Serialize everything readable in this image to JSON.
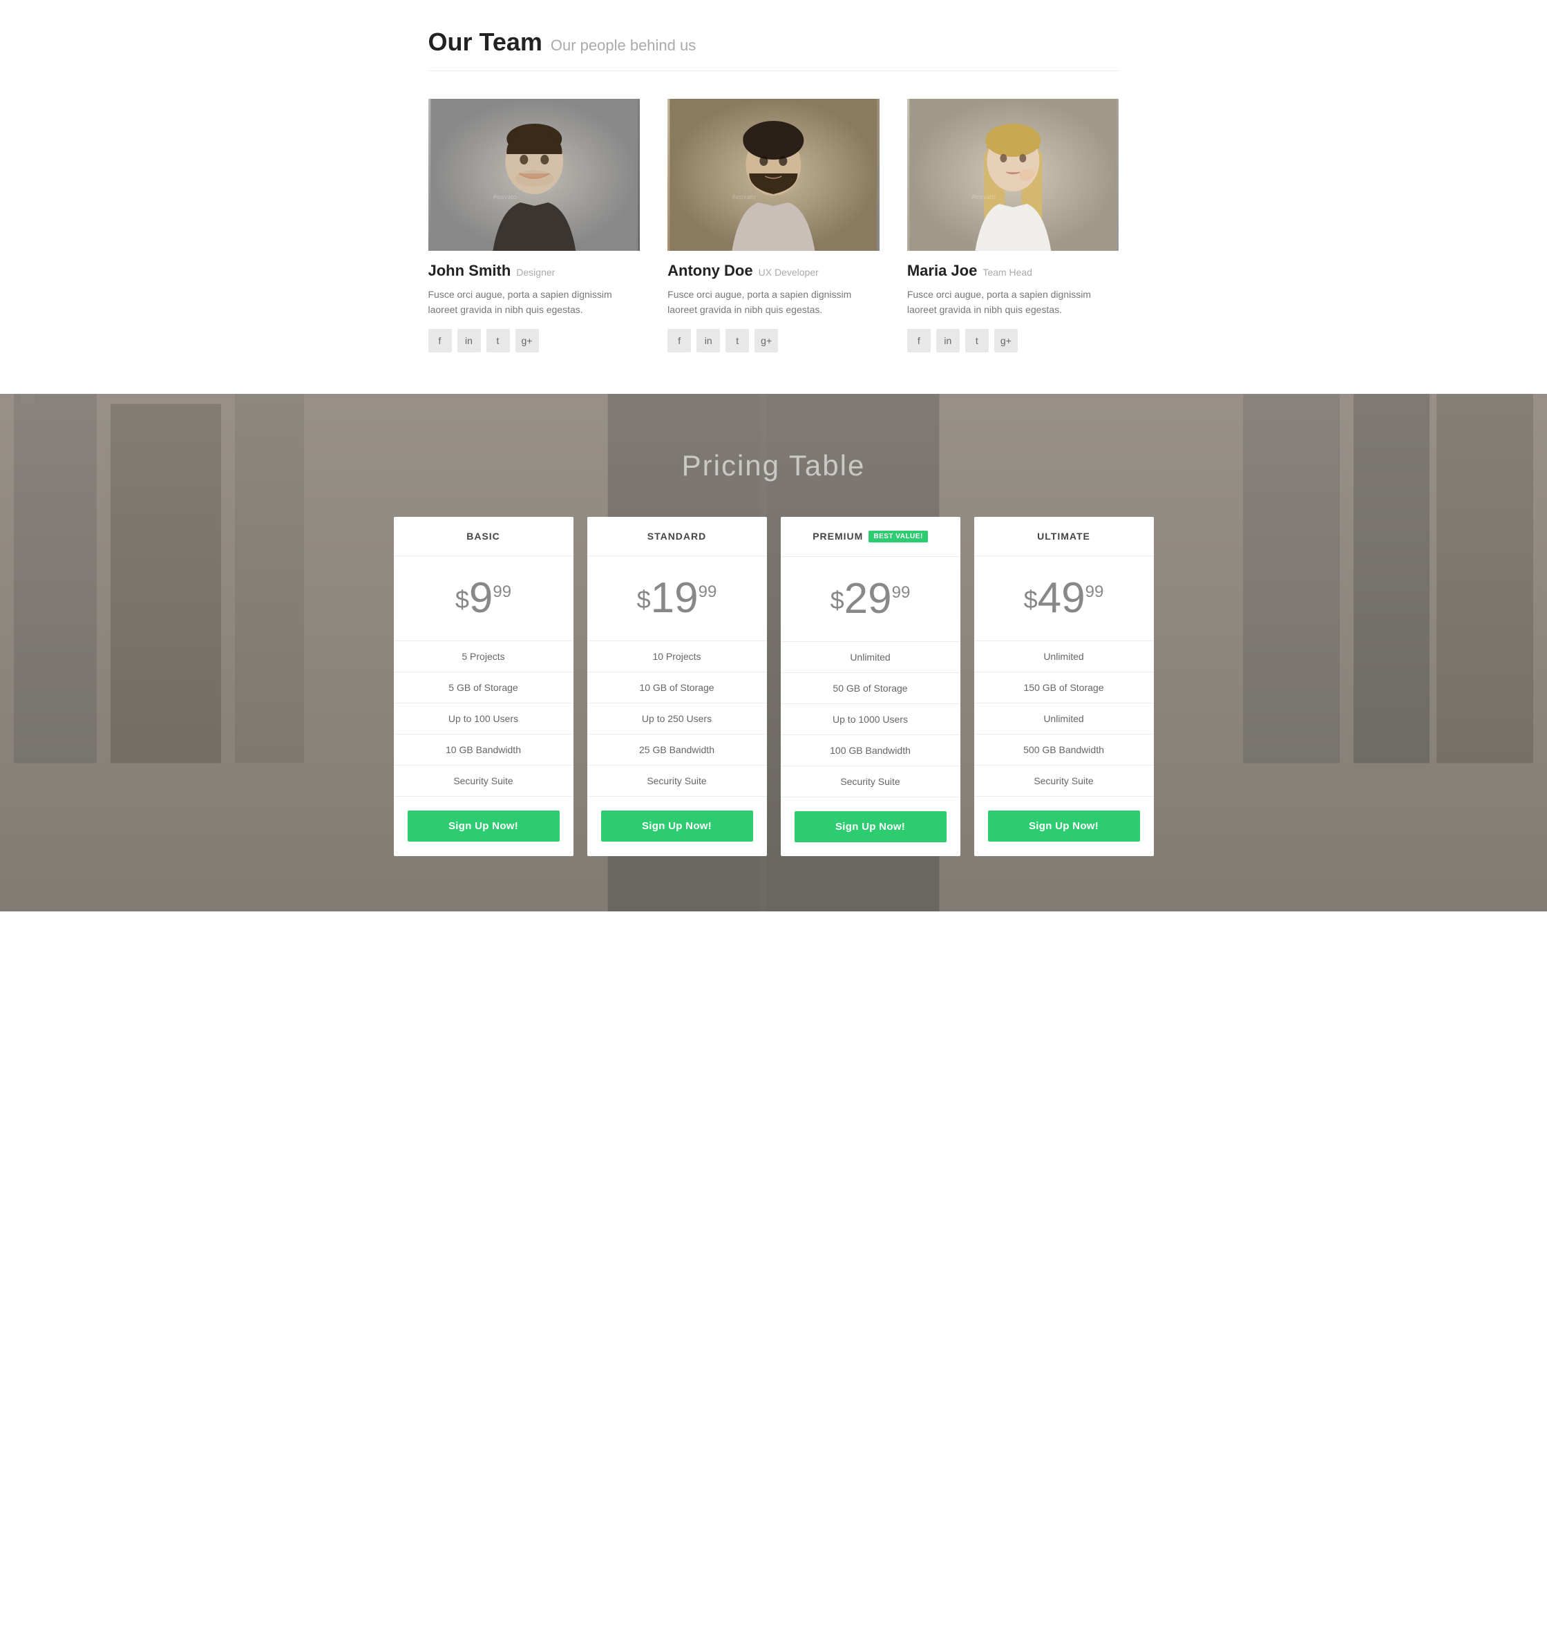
{
  "team": {
    "title": "Our Team",
    "subtitle": "Our people behind us",
    "members": [
      {
        "name": "John Smith",
        "role": "Designer",
        "bio": "Fusce orci augue, porta a sapien dignissim laoreet gravida in nibh quis egestas.",
        "photo_class": "photo-1",
        "socials": [
          "f",
          "in",
          "t",
          "g+"
        ]
      },
      {
        "name": "Antony Doe",
        "role": "UX Developer",
        "bio": "Fusce orci augue, porta a sapien dignissim laoreet gravida in nibh quis egestas.",
        "photo_class": "photo-2",
        "socials": [
          "f",
          "in",
          "t",
          "g+"
        ]
      },
      {
        "name": "Maria Joe",
        "role": "Team Head",
        "bio": "Fusce orci augue, porta a sapien dignissim laoreet gravida in nibh quis egestas.",
        "photo_class": "photo-3",
        "socials": [
          "f",
          "in",
          "t",
          "g+"
        ]
      }
    ]
  },
  "pricing": {
    "title": "Pricing Table",
    "plans": [
      {
        "name": "BASIC",
        "price_dollar": "$",
        "price_main": "9",
        "price_cents": "99",
        "features": [
          "5 Projects",
          "5 GB of Storage",
          "Up to 100 Users",
          "10 GB Bandwidth",
          "Security Suite"
        ],
        "cta": "Sign Up Now!",
        "best_value": false
      },
      {
        "name": "STANDARD",
        "price_dollar": "$",
        "price_main": "19",
        "price_cents": "99",
        "features": [
          "10 Projects",
          "10 GB of Storage",
          "Up to 250 Users",
          "25 GB Bandwidth",
          "Security Suite"
        ],
        "cta": "Sign Up Now!",
        "best_value": false
      },
      {
        "name": "PREMIUM",
        "price_dollar": "$",
        "price_main": "29",
        "price_cents": "99",
        "features": [
          "Unlimited",
          "50 GB of Storage",
          "Up to 1000 Users",
          "100 GB Bandwidth",
          "Security Suite"
        ],
        "cta": "Sign Up Now!",
        "best_value": true,
        "badge": "BEST VALUE!"
      },
      {
        "name": "ULTIMATE",
        "price_dollar": "$",
        "price_main": "49",
        "price_cents": "99",
        "features": [
          "Unlimited",
          "150 GB of Storage",
          "Unlimited",
          "500 GB Bandwidth",
          "Security Suite"
        ],
        "cta": "Sign Up Now!",
        "best_value": false
      }
    ]
  },
  "social_icons": {
    "facebook": "f",
    "linkedin": "in",
    "twitter": "t",
    "google": "g+"
  }
}
